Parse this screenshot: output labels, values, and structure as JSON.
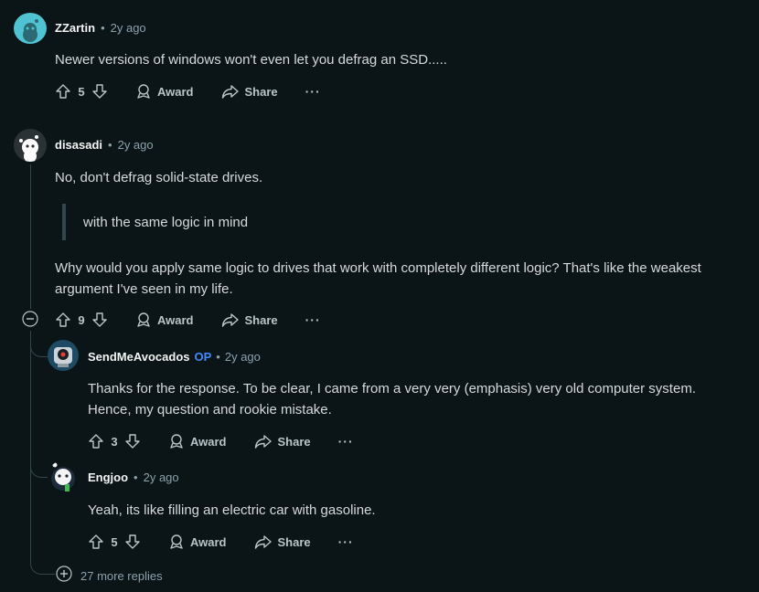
{
  "comments": [
    {
      "author": "ZZartin",
      "time": "2y ago",
      "body": "Newer versions of windows won't even let you defrag an SSD.....",
      "votes": "5",
      "award": "Award",
      "share": "Share"
    },
    {
      "author": "disasadi",
      "time": "2y ago",
      "body1": "No, don't defrag solid-state drives.",
      "quote": "with the same logic in mind",
      "body2a": "Why would you apply same logic to drives that work with completely different logic? That's like the weakest",
      "body2b": "argument I've seen in my life.",
      "votes": "9",
      "award": "Award",
      "share": "Share"
    },
    {
      "author": "SendMeAvocados",
      "op_badge": "OP",
      "time": "2y ago",
      "body1": "Thanks for the response. To be clear, I came from a very very (emphasis) very old computer system.",
      "body2": "Hence, my question and rookie mistake.",
      "votes": "3",
      "award": "Award",
      "share": "Share"
    },
    {
      "author": "Engjoo",
      "time": "2y ago",
      "body": "Yeah, its like filling an electric car with gasoline.",
      "votes": "5",
      "award": "Award",
      "share": "Share"
    }
  ],
  "more_replies": "27 more replies",
  "separator": "•"
}
